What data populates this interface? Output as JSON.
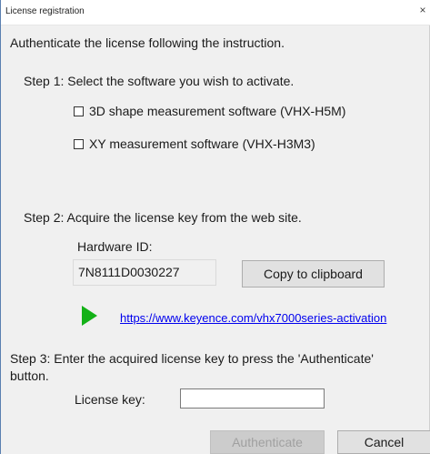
{
  "window": {
    "title": "License registration",
    "close_glyph": "×"
  },
  "intro": "Authenticate the license following the instruction.",
  "step1": {
    "label": "Step 1: Select the software you wish to activate.",
    "options": [
      {
        "label": "3D shape measurement software (VHX-H5M)",
        "checked": false
      },
      {
        "label": "XY measurement software (VHX-H3M3)",
        "checked": false
      }
    ]
  },
  "step2": {
    "label": "Step 2: Acquire the license key from the web site.",
    "hardware_id_label": "Hardware ID:",
    "hardware_id_value": "7N8111D0030227",
    "copy_button": "Copy to clipboard",
    "link_url": "https://www.keyence.com/vhx7000series-activation",
    "link_icon": "play-icon",
    "link_icon_color": "#13b117"
  },
  "step3": {
    "label_line1": "Step 3: Enter the acquired license key to press the 'Authenticate'",
    "label_line2": "button.",
    "license_key_label": "License key:",
    "license_key_value": ""
  },
  "footer": {
    "authenticate_button": "Authenticate",
    "cancel_button": "Cancel"
  }
}
